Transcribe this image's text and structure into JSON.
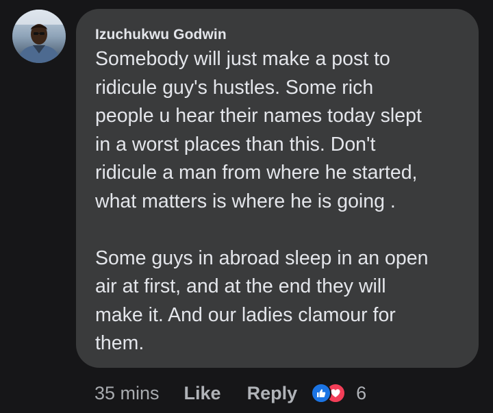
{
  "comment": {
    "author": "Izuchukwu Godwin",
    "lines": [
      "Somebody will just make a post to",
      "ridicule guy's hustles. Some rich",
      "people u hear their names today slept",
      "in a worst places than this. Don't",
      "ridicule a man from where he started,",
      "what matters is where he is going ."
    ],
    "lines2": [
      "Some guys in abroad sleep in an open",
      "air at first, and at the end they will",
      "make it. And our ladies clamour for",
      "them."
    ]
  },
  "meta": {
    "time": "35 mins",
    "like_label": "Like",
    "reply_label": "Reply",
    "reaction_count": "6",
    "reactions": [
      "like-icon",
      "love-icon"
    ]
  },
  "colors": {
    "background": "#161618",
    "bubble": "#3a3b3c",
    "text": "#e4e6eb",
    "meta": "#b0b3b8",
    "like_blue": "#1b74e4",
    "love_red": "#f33e58"
  }
}
